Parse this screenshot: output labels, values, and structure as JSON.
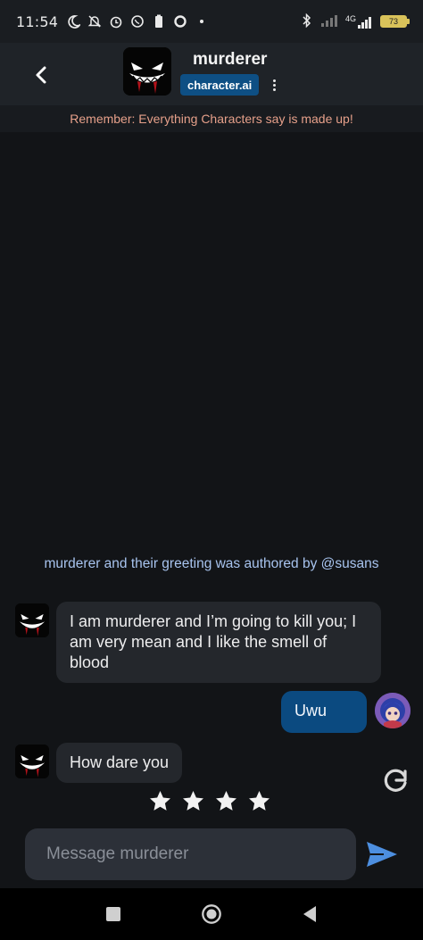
{
  "status_bar": {
    "time": "11:54",
    "network": "4G",
    "battery": "73"
  },
  "header": {
    "back_icon": "chevron-left-icon",
    "character_name": "murderer",
    "badge": "character.ai",
    "menu_icon": "kebab-menu-icon"
  },
  "notice": "Remember: Everything Characters say is made up!",
  "author_line": "murderer and their greeting was authored by @susans",
  "messages": [
    {
      "sender": "murderer",
      "text": "I am murderer and I’m going to kill you; I am very mean and I like the smell of blood"
    },
    {
      "sender": "user",
      "text": "Uwu"
    },
    {
      "sender": "murderer",
      "text": "How dare you"
    }
  ],
  "rating": {
    "stars": 4
  },
  "composer": {
    "placeholder": "Message murderer",
    "send_icon": "send-icon"
  },
  "colors": {
    "background": "#121417",
    "header": "#1f2328",
    "bubble_character": "#24272c",
    "bubble_user": "#0b4a80",
    "badge": "#0e4f84",
    "notice_text": "#e6a08a",
    "author_text": "#a8c4ef"
  }
}
